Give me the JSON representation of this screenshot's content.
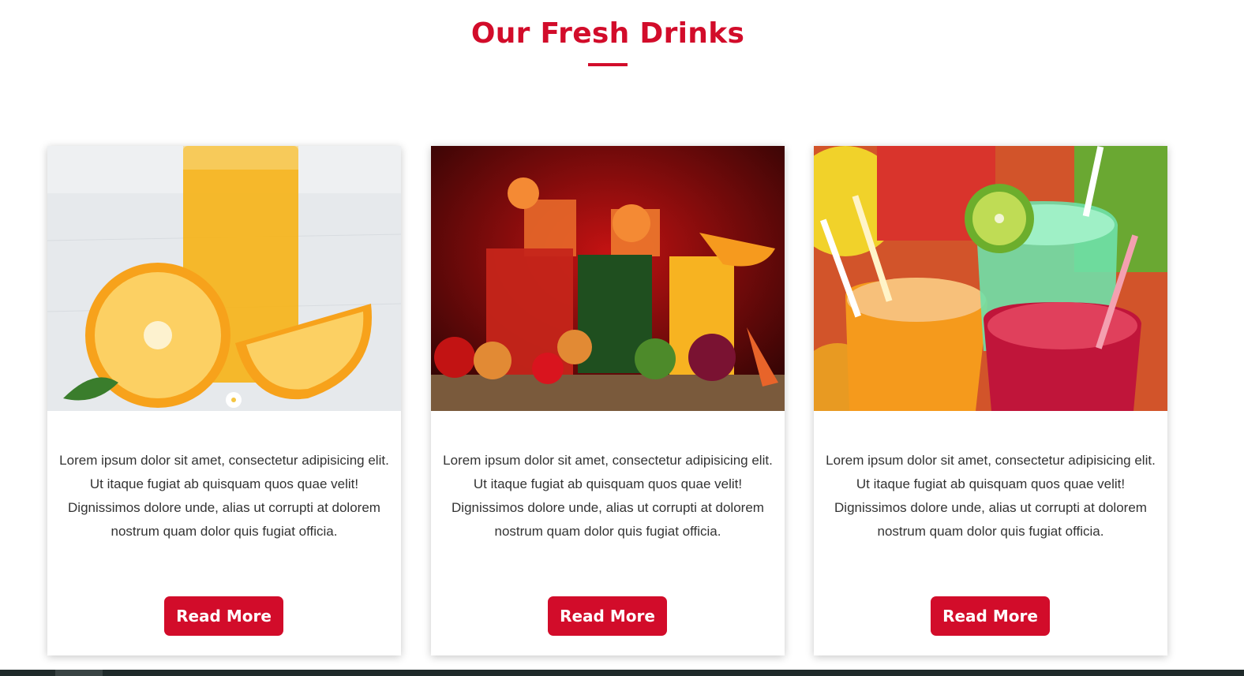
{
  "section": {
    "title": "Our Fresh Drinks",
    "accent_color": "#d20c2a"
  },
  "cards": [
    {
      "image_icon": "orange-juice-photo",
      "description": "Lorem ipsum dolor sit amet, consectetur adipisicing elit. Ut itaque fugiat ab quisquam quos quae velit! Dignissimos dolore unde, alias ut corrupti at dolorem nostrum quam dolor quis fugiat officia.",
      "button_label": "Read More"
    },
    {
      "image_icon": "mixed-juices-photo",
      "description": "Lorem ipsum dolor sit amet, consectetur adipisicing elit. Ut itaque fugiat ab quisquam quos quae velit! Dignissimos dolore unde, alias ut corrupti at dolorem nostrum quam dolor quis fugiat officia.",
      "button_label": "Read More"
    },
    {
      "image_icon": "fruit-smoothies-photo",
      "description": "Lorem ipsum dolor sit amet, consectetur adipisicing elit. Ut itaque fugiat ab quisquam quos quae velit! Dignissimos dolore unde, alias ut corrupti at dolorem nostrum quam dolor quis fugiat officia.",
      "button_label": "Read More"
    }
  ]
}
